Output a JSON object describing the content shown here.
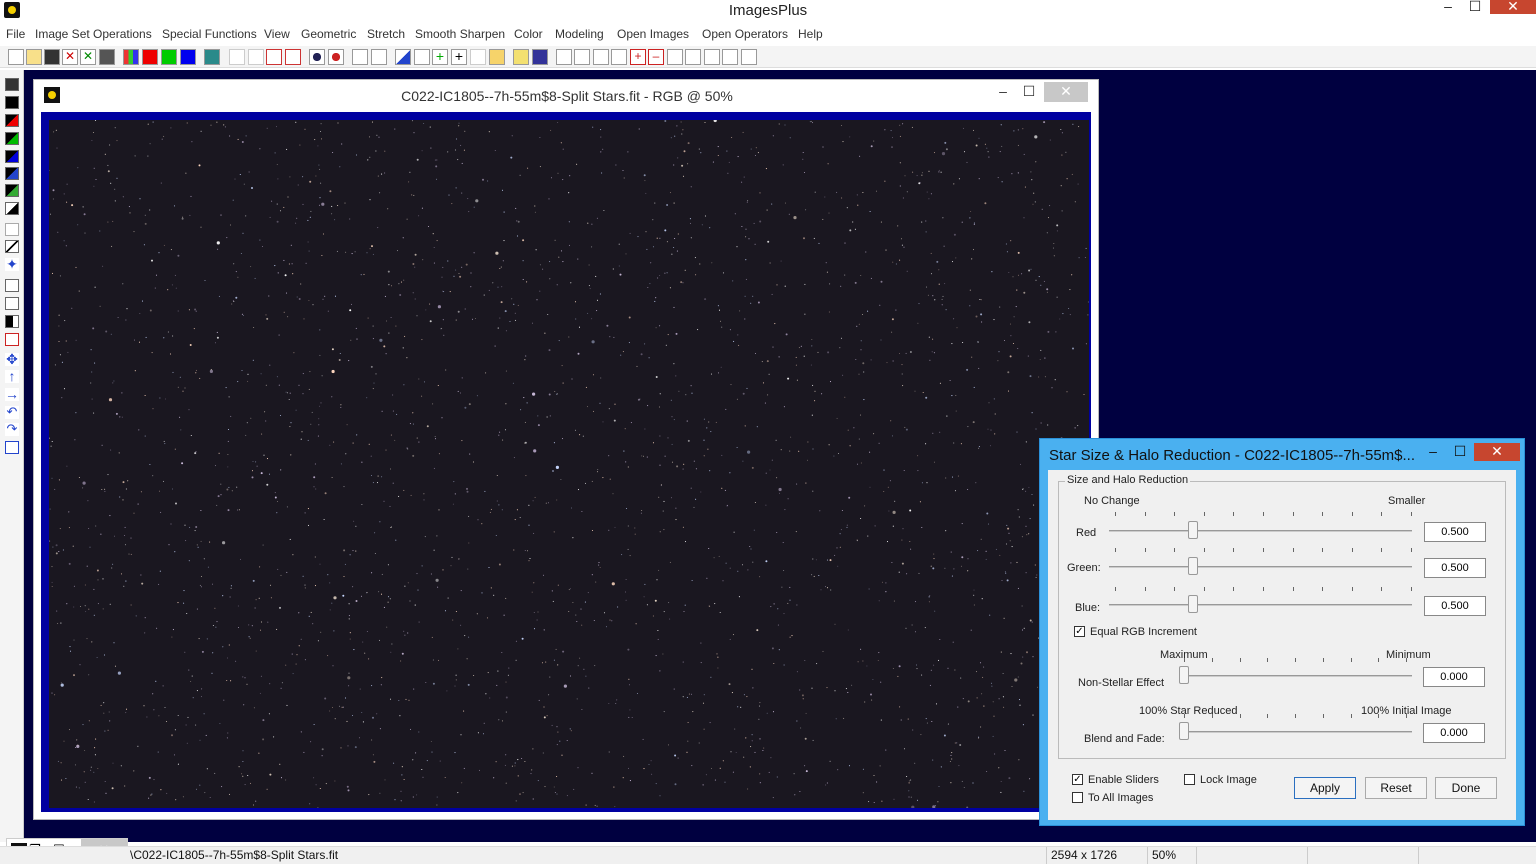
{
  "app": {
    "title": "ImagesPlus"
  },
  "window_controls": {
    "minimize": "–",
    "maximize": "☐",
    "close": "✕"
  },
  "menu": [
    "File",
    "Image Set Operations",
    "Special Functions",
    "View",
    "Geometric",
    "Stretch",
    "Smooth Sharpen",
    "Color",
    "Modeling",
    "Open Images",
    "Open Operators",
    "Help"
  ],
  "image_window": {
    "title": "C022-IC1805--7h-55m$8-Split Stars.fit - RGB @ 50%",
    "controls": {
      "minimize": "–",
      "maximize": "☐",
      "close": "✕"
    }
  },
  "dialog": {
    "title": "Star Size & Halo Reduction - C022-IC1805--7h-55m$...",
    "controls": {
      "minimize": "–",
      "maximize": "☐",
      "close": "✕"
    },
    "group_label": "Size and Halo Reduction",
    "size_header": {
      "left": "No Change",
      "right": "Smaller"
    },
    "sliders": [
      {
        "label": "Red",
        "value": "0.500",
        "level": 0.27
      },
      {
        "label": "Green:",
        "value": "0.500",
        "level": 0.27
      },
      {
        "label": "Blue:",
        "value": "0.500",
        "level": 0.27
      }
    ],
    "equal_rgb": {
      "label": "Equal RGB Increment",
      "checked": true
    },
    "non_stellar": {
      "header_left": "Maximum",
      "header_right": "Minimum",
      "label": "Non-Stellar Effect",
      "value": "0.000",
      "level": 0.0
    },
    "blend": {
      "header_left": "100% Star Reduced",
      "header_right": "100% Initial Image",
      "label": "Blend and Fade:",
      "value": "0.000",
      "level": 0.0
    },
    "enable_sliders": {
      "label": "Enable Sliders",
      "checked": true
    },
    "to_all_images": {
      "label": "To All Images",
      "checked": false
    },
    "lock_image": {
      "label": "Lock Image",
      "checked": false
    },
    "buttons": {
      "apply": "Apply",
      "reset": "Reset",
      "done": "Done"
    },
    "check_mark": "✓"
  },
  "minimized_tab": {
    "controls": {
      "restore": "❐",
      "maximize": "☐",
      "close": "✕"
    }
  },
  "status": {
    "path": "\\C022-IC1805--7h-55m$8-Split Stars.fit",
    "dimensions": "2594 x 1726",
    "zoom": "50%"
  },
  "colors": {
    "workspace_bg": "#000040",
    "image_frame": "#0000a0",
    "dialog_border": "#4ab0f0",
    "close_red": "#c7462f"
  }
}
